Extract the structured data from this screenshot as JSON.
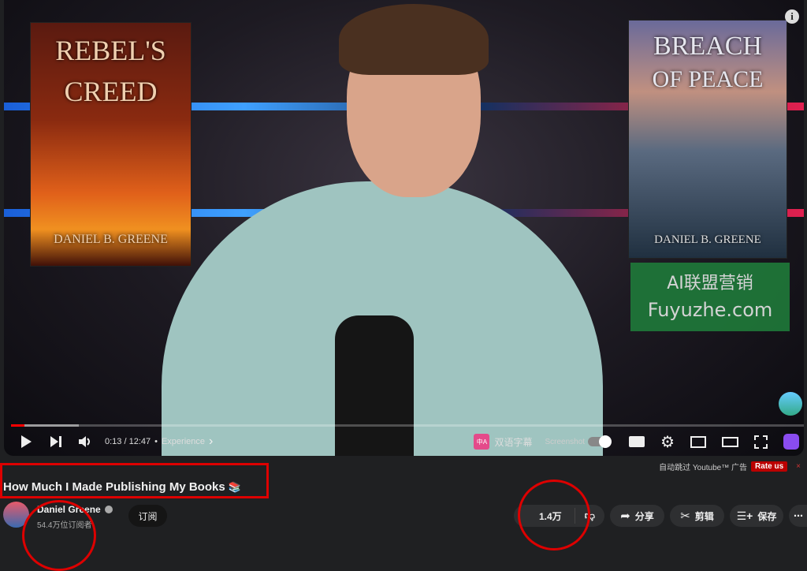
{
  "video": {
    "cover_left": {
      "title_line1": "REBEL'S",
      "title_line2": "CREED",
      "author": "DANIEL B. GREENE"
    },
    "cover_right": {
      "title_line1": "BREACH",
      "title_line2": "OF PEACE",
      "author": "DANIEL B. GREENE"
    },
    "watermark": {
      "line1": "AI联盟营销",
      "line2": "Fuyuzhe.com"
    },
    "info_label": "i",
    "progress_percent": 1.7,
    "buffered_percent": 8.5
  },
  "controls": {
    "time": "0:13 / 12:47",
    "separator": "•",
    "chapter": "Experience",
    "chapter_arrow": "›",
    "bilingual_label": "双语字幕",
    "bilingual_icon": "中A",
    "screenshot_label": "Screenshot"
  },
  "adbar": {
    "text": "自动跳过 Youtube™ 广告",
    "rate_label": "Rate us",
    "close": "×"
  },
  "video_title": "How Much I Made Publishing My Books",
  "title_emoji": "📚",
  "channel": {
    "name": "Daniel Greene",
    "subscribers": "54.4万位订阅者",
    "subscribe_label": "订阅"
  },
  "actions": {
    "likes": "1.4万",
    "share": "分享",
    "clip": "剪辑",
    "save": "保存",
    "more": "⋯"
  },
  "colors": {
    "accent_red": "#ff0000",
    "annotation_red": "#dd0000",
    "background": "#1f2022"
  }
}
